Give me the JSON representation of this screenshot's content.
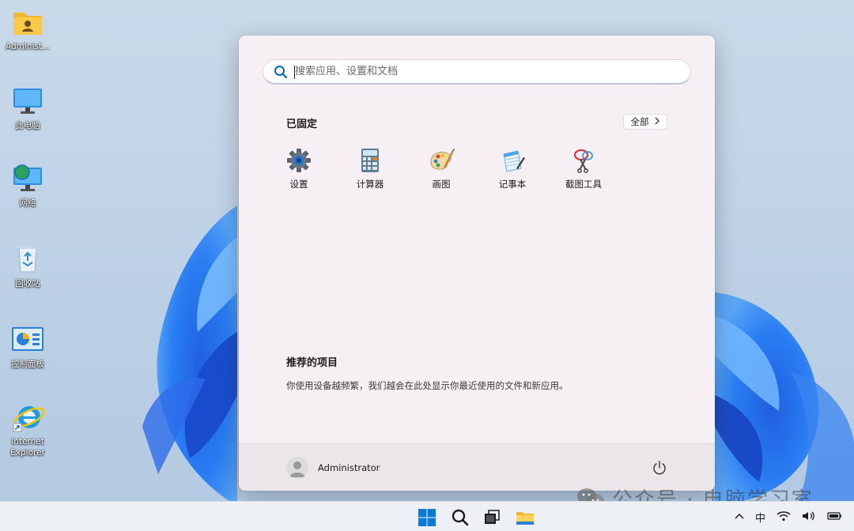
{
  "desktop": {
    "icons": [
      {
        "label": "Administ..."
      },
      {
        "label": "此电脑"
      },
      {
        "label": "网络"
      },
      {
        "label": "回收站"
      },
      {
        "label": "控制面板"
      },
      {
        "label": "Internet Explorer"
      }
    ]
  },
  "start_menu": {
    "search": {
      "placeholder": "搜索应用、设置和文档"
    },
    "pinned": {
      "title": "已固定",
      "all_button": "全部",
      "apps": [
        {
          "label": "设置",
          "icon": "gear-icon"
        },
        {
          "label": "计算器",
          "icon": "calculator-icon"
        },
        {
          "label": "画图",
          "icon": "paint-palette-icon"
        },
        {
          "label": "记事本",
          "icon": "notepad-icon"
        },
        {
          "label": "截图工具",
          "icon": "scissors-icon"
        }
      ]
    },
    "recommended": {
      "title": "推荐的项目",
      "description": "你使用设备越频繁，我们越会在此处显示你最近使用的文件和新应用。"
    },
    "user": {
      "name": "Administrator"
    }
  },
  "taskbar": {
    "tray": {
      "language": "中"
    }
  },
  "watermark": {
    "text": "公众号 · 电脑学习室"
  },
  "colors": {
    "accent": "#0067c0",
    "start_bg": "#f6f0f4",
    "taskbar_bg": "#edf1f6"
  }
}
